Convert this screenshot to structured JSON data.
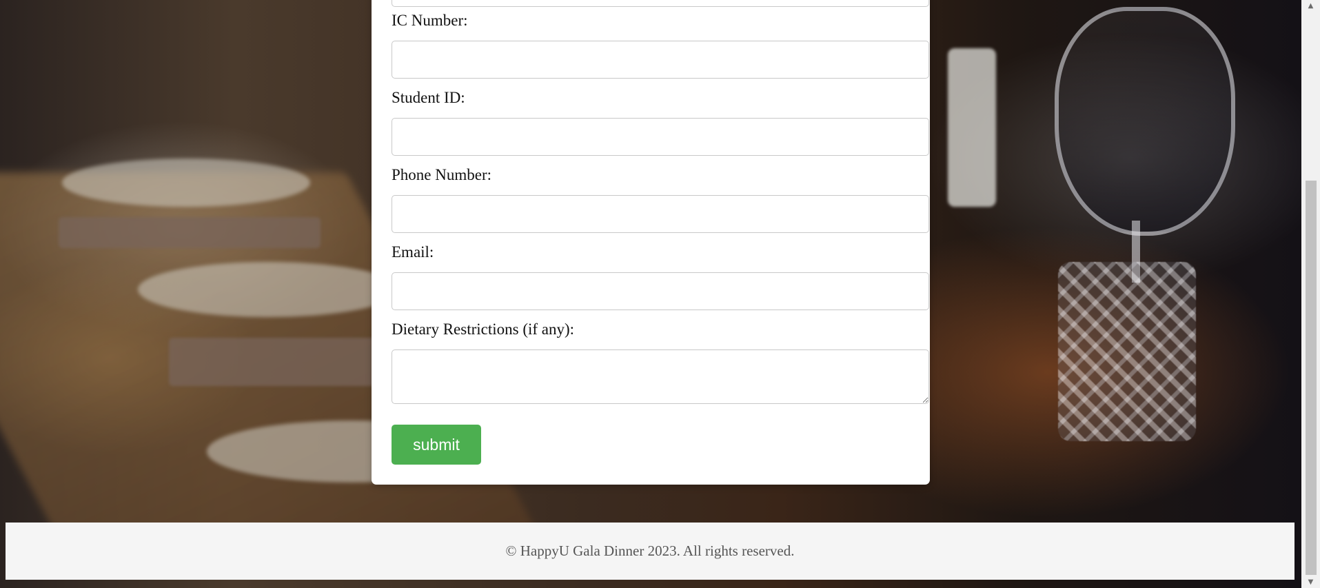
{
  "form": {
    "fields": [
      {
        "label": "IC Number:",
        "value": ""
      },
      {
        "label": "Student ID:",
        "value": ""
      },
      {
        "label": "Phone Number:",
        "value": ""
      },
      {
        "label": "Email:",
        "value": ""
      }
    ],
    "dietary": {
      "label": "Dietary Restrictions (if any):",
      "value": ""
    },
    "submit_label": "submit"
  },
  "footer": {
    "text": "© HappyU Gala Dinner 2023. All rights reserved."
  },
  "scrollbar": {
    "up_icon": "▲",
    "down_icon": "▼"
  },
  "colors": {
    "submit_button": "#4caf50",
    "footer_background": "#f5f5f5"
  }
}
